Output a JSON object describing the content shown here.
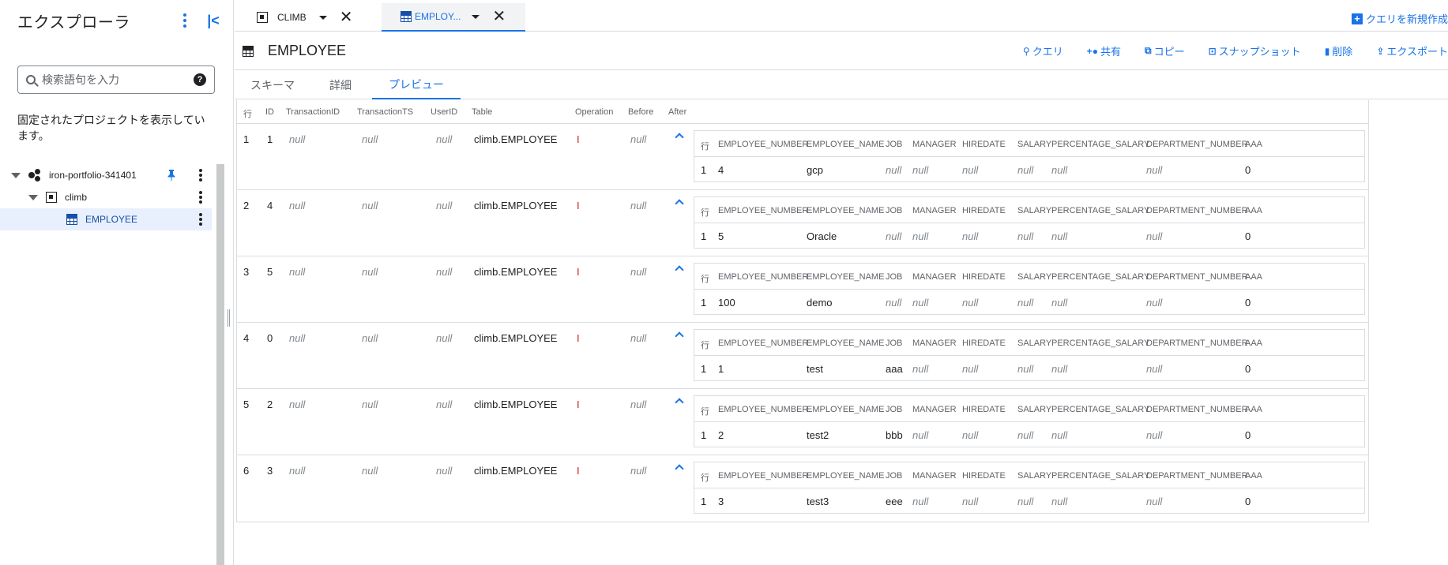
{
  "sidebar": {
    "title": "エクスプローラ",
    "search_placeholder": "検索語句を入力",
    "pinned_text": "固定されたプロジェクトを表示しています。",
    "project": "iron-portfolio-341401",
    "dataset": "climb",
    "table": "EMPLOYEE"
  },
  "tabs": {
    "tab1_label": "CLIMB",
    "tab2_label": "EMPLOY...",
    "new_query": "クエリを新規作成"
  },
  "header": {
    "title": "EMPLOYEE",
    "actions": [
      "クエリ",
      "共有",
      "コピー",
      "スナップショット",
      "削除",
      "エクスポート"
    ]
  },
  "subtabs": [
    "スキーマ",
    "詳細",
    "プレビュー"
  ],
  "results": {
    "columns": [
      "行",
      "ID",
      "TransactionID",
      "TransactionTS",
      "UserID",
      "Table",
      "Operation",
      "Before",
      "After"
    ],
    "nested_columns": [
      "行",
      "EMPLOYEE_NUMBER",
      "EMPLOYEE_NAME",
      "JOB",
      "MANAGER",
      "HIREDATE",
      "SALARY",
      "PERCENTAGE_SALARY",
      "DEPARTMENT_NUMBER",
      "AAA"
    ],
    "null_text": "null",
    "rows": [
      {
        "row": "1",
        "id": "1",
        "table": "climb.EMPLOYEE",
        "op": "I",
        "after": {
          "row": "1",
          "emp_no": "4",
          "emp_name": "gcp",
          "job": "null",
          "aaa": "0"
        }
      },
      {
        "row": "2",
        "id": "4",
        "table": "climb.EMPLOYEE",
        "op": "I",
        "after": {
          "row": "1",
          "emp_no": "5",
          "emp_name": "Oracle",
          "job": "null",
          "aaa": "0"
        }
      },
      {
        "row": "3",
        "id": "5",
        "table": "climb.EMPLOYEE",
        "op": "I",
        "after": {
          "row": "1",
          "emp_no": "100",
          "emp_name": "demo",
          "job": "null",
          "aaa": "0"
        }
      },
      {
        "row": "4",
        "id": "0",
        "table": "climb.EMPLOYEE",
        "op": "I",
        "after": {
          "row": "1",
          "emp_no": "1",
          "emp_name": "test",
          "job": "aaa",
          "aaa": "0"
        }
      },
      {
        "row": "5",
        "id": "2",
        "table": "climb.EMPLOYEE",
        "op": "I",
        "after": {
          "row": "1",
          "emp_no": "2",
          "emp_name": "test2",
          "job": "bbb",
          "aaa": "0"
        }
      },
      {
        "row": "6",
        "id": "3",
        "table": "climb.EMPLOYEE",
        "op": "I",
        "after": {
          "row": "1",
          "emp_no": "3",
          "emp_name": "test3",
          "job": "eee",
          "aaa": "0"
        }
      }
    ]
  }
}
